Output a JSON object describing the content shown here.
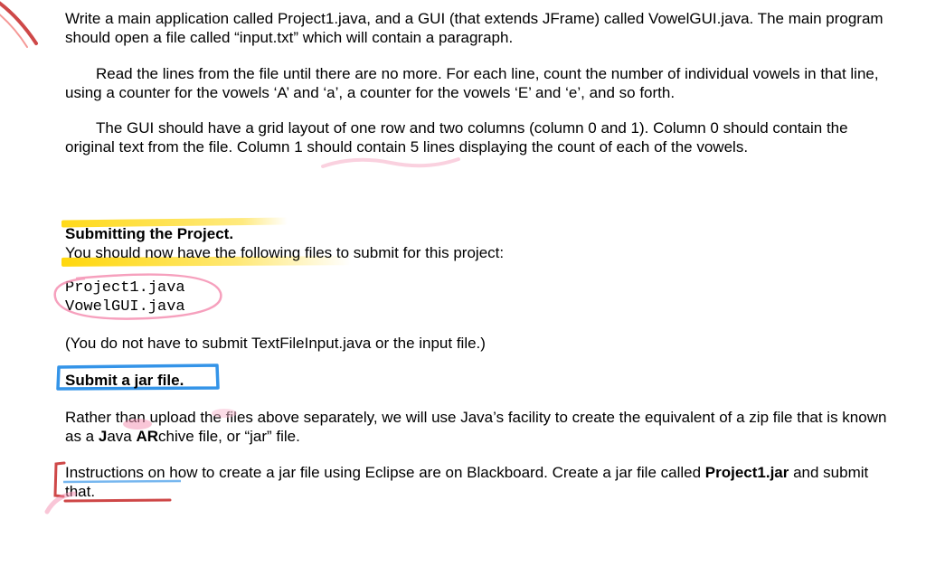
{
  "intro": {
    "p1": "Write a main application called Project1.java, and a GUI (that extends JFrame) called VowelGUI.java. The main program should open a file called “input.txt” which will contain a paragraph.",
    "p2": "Read the lines from the file until there are no more. For each line, count the number of individual vowels in that line, using a counter for the vowels ‘A’ and ‘a’, a counter for the vowels ‘E’ and ‘e’, and so forth.",
    "p3": "The GUI should have a grid layout of one row and two columns (column 0 and 1). Column 0 should contain the original text from the file. Column 1 should contain 5 lines displaying the count of each of the vowels."
  },
  "submit": {
    "heading": "Submitting the Project.",
    "you_line": "You should now have the following files to submit for this project:",
    "file1": "Project1.java",
    "file2": "VowelGUI.java",
    "note": "(You do not have to submit TextFileInput.java or the input file.)",
    "jar_heading": "Submit a jar file.",
    "rather_prefix": "Rather than upload the files above separately, we will use Java’s facility to create the equivalent of a zip file that is known as a ",
    "jar_bold1": "J",
    "jar_mid1": "ava ",
    "jar_bold2": "AR",
    "jar_mid2": "chive file, or “jar” file.",
    "instr_prefix": "Instructions on how to create a jar file using Eclipse are on Blackboard. Create a jar file called ",
    "instr_bold": "Project1.jar",
    "instr_suffix": " and submit that."
  }
}
